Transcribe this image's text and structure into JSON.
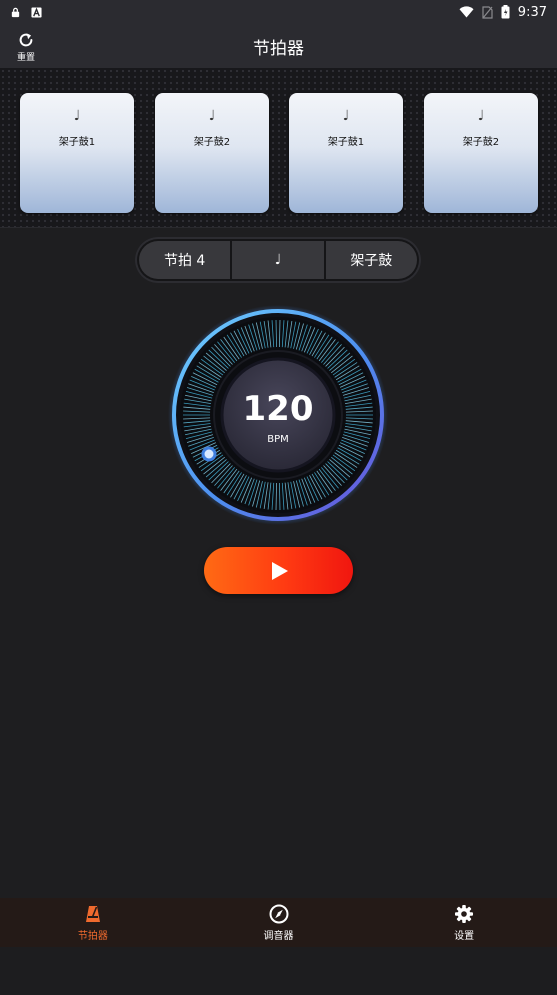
{
  "status_bar": {
    "time": "9:37",
    "icons": [
      "lock-icon",
      "text-a-icon",
      "wifi-icon",
      "no-sim-icon",
      "battery-icon"
    ]
  },
  "app_bar": {
    "title": "节拍器",
    "reset_label": "重置"
  },
  "pads": [
    {
      "note": "♩",
      "label": "架子鼓1"
    },
    {
      "note": "♩",
      "label": "架子鼓2"
    },
    {
      "note": "♩",
      "label": "架子鼓1"
    },
    {
      "note": "♩",
      "label": "架子鼓2"
    }
  ],
  "controls": {
    "beat": "节拍 4",
    "note": "♩",
    "sound": "架子鼓"
  },
  "tempo": {
    "bpm": "120",
    "unit": "BPM"
  },
  "bottom_nav": [
    {
      "label": "节拍器",
      "icon": "metronome-icon",
      "active": true
    },
    {
      "label": "调音器",
      "icon": "tuner-icon",
      "active": false
    },
    {
      "label": "设置",
      "icon": "settings-icon",
      "active": false
    }
  ],
  "colors": {
    "accent_active": "#ef6a2e",
    "play_start": "#ff6a14",
    "play_end": "#f0160f",
    "dial_ring": "#5aa6ee",
    "pad_top": "#f3f5f9",
    "pad_bottom": "#9fb6d8"
  }
}
